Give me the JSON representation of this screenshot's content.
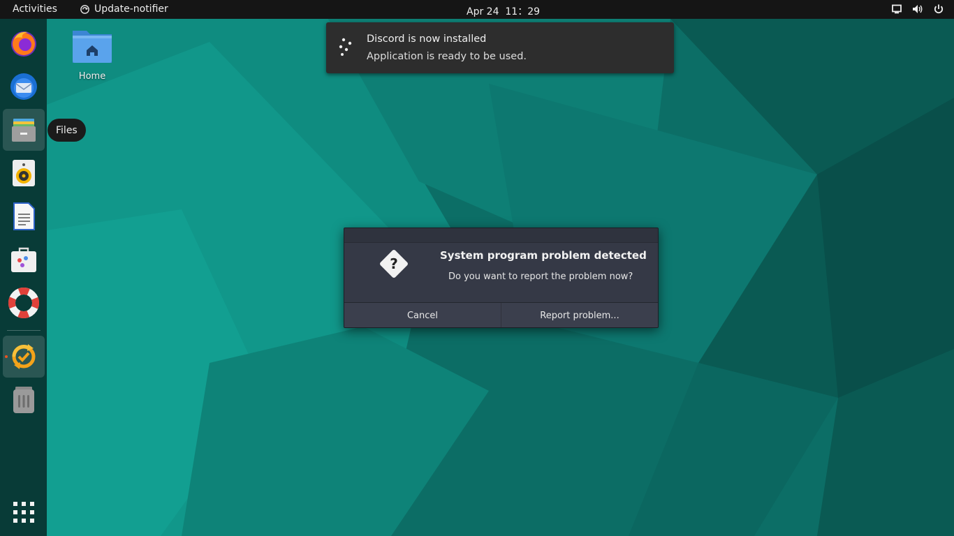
{
  "topbar": {
    "activities_label": "Activities",
    "app_menu_label": "Update-notifier",
    "clock_date": "Apr 24",
    "clock_time": "11：29",
    "tray_icons": [
      "screen-icon",
      "volume-icon",
      "power-icon"
    ]
  },
  "dock": {
    "items": [
      {
        "name": "firefox",
        "icon": "firefox-icon"
      },
      {
        "name": "thunderbird",
        "icon": "thunderbird-icon"
      },
      {
        "name": "files",
        "icon": "files-icon",
        "highlighted": true
      },
      {
        "name": "rhythmbox",
        "icon": "speaker-icon"
      },
      {
        "name": "libreoffice-writer",
        "icon": "document-icon"
      },
      {
        "name": "software",
        "icon": "software-store-icon"
      },
      {
        "name": "help",
        "icon": "lifebuoy-icon"
      },
      {
        "name": "software-updater",
        "icon": "updater-icon",
        "running": true,
        "highlighted": true
      },
      {
        "name": "trash",
        "icon": "trash-icon"
      }
    ],
    "show_apps_icon": "grid-icon",
    "tooltip": "Files"
  },
  "desktop": {
    "home_label": "Home"
  },
  "notification": {
    "title": "Discord is now installed",
    "body": "Application is ready to be used."
  },
  "dialog": {
    "title": "System program problem detected",
    "message": "Do you want to report the problem now?",
    "cancel_label": "Cancel",
    "report_label": "Report problem..."
  },
  "colors": {
    "accent": "#e95420",
    "wallpaper_base": "#0d6b63",
    "dialog_bg": "#353946",
    "topbar_bg": "#151515"
  }
}
